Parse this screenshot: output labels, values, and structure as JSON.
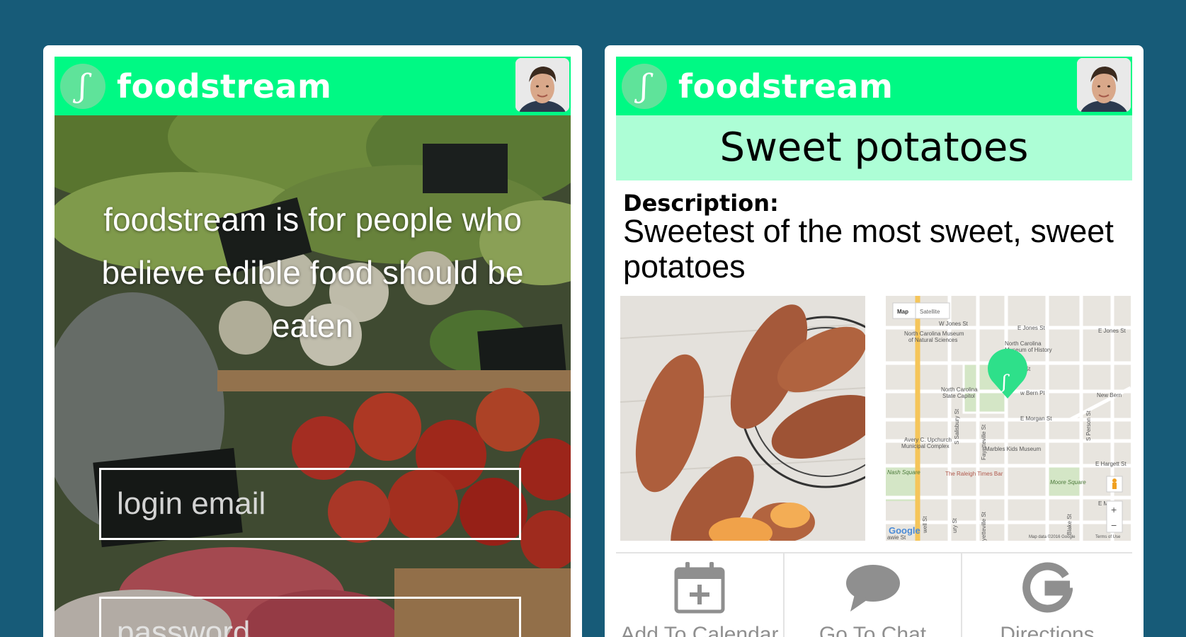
{
  "app": {
    "brand_name": "foodstream",
    "logo_glyph": "ʃ",
    "colors": {
      "background": "#175b78",
      "header": "#00f984",
      "title_bar": "#adfed6",
      "action_gray": "#8f8f8f",
      "map_pin": "#2ee08a"
    }
  },
  "login_screen": {
    "tagline": "foodstream is for people who believe edible food should be eaten",
    "email_placeholder": "login email",
    "password_placeholder": "password"
  },
  "detail_screen": {
    "title": "Sweet potatoes",
    "description_label": "Description:",
    "description_text": "Sweetest of the most sweet, sweet potatoes",
    "map": {
      "tab_map": "Map",
      "tab_satellite": "Satellite",
      "labels": {
        "w_jones": "W Jones St",
        "e_jones": "E Jones St",
        "e_jones_right": "E Jones St",
        "museum_natural_1": "North Carolina Museum",
        "museum_natural_2": "of Natural Sciences",
        "museum_history_1": "North Carolina",
        "museum_history_2": "Museum of History",
        "edenton": "n St",
        "capitol_1": "North Carolina",
        "capitol_2": "State Capitol",
        "new_bern_pl": "w Bern Pl",
        "new_bern": "New Bern",
        "e_morgan": "E Morgan St",
        "avery_1": "Avery C. Upchurch",
        "avery_2": "Municipal Complex",
        "marbles": "Marbles Kids Museum",
        "nash": "Nash Square",
        "times": "The Raleigh Times Bar",
        "moore": "Moore Square",
        "hargett": "E Hargett St",
        "e_ma": "E Ma",
        "salisbury": "S Salisbury St",
        "fayetteville": "Fayetteville St",
        "fayetteville2": "yetteville St",
        "person": "S Person St",
        "blake": "Blake St",
        "dowell": "well St",
        "ury": "ury St",
        "google": "Google",
        "copyright": "Map data ©2016 Google",
        "terms": "Terms of Use",
        "dawson": "awie St",
        "zoom_in": "+",
        "zoom_out": "−"
      }
    },
    "actions": [
      {
        "label": "Add To Calendar",
        "icon": "calendar-add-icon"
      },
      {
        "label": "Go To Chat",
        "icon": "chat-bubble-icon"
      },
      {
        "label": "Directions",
        "icon": "google-g-icon"
      }
    ]
  }
}
